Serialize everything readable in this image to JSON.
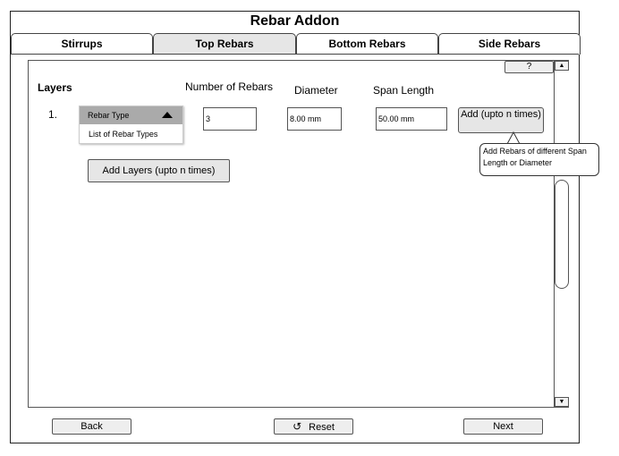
{
  "window": {
    "title": "Rebar Addon"
  },
  "tabs": [
    {
      "label": "Stirrups",
      "active": false
    },
    {
      "label": "Top Rebars",
      "active": true
    },
    {
      "label": "Bottom Rebars",
      "active": false
    },
    {
      "label": "Side Rebars",
      "active": false
    }
  ],
  "panel": {
    "help_label": "?",
    "layers_heading": "Layers",
    "columns": {
      "number_of_rebars": "Number of Rebars",
      "diameter": "Diameter",
      "span_length": "Span Length"
    },
    "row": {
      "index": "1.",
      "rebar_type": {
        "selected": "Rebar Type",
        "options": [
          "List of Rebar Types"
        ]
      },
      "number_of_rebars": "3",
      "diameter": "8.00 mm",
      "span_length": "50.00 mm",
      "add_label": "Add (upto n times)"
    },
    "tooltip": "Add Rebars of different Span Length or Diameter",
    "add_layers_label": "Add Layers (upto n times)"
  },
  "footer": {
    "back_label": "Back",
    "reset_label": "Reset",
    "next_label": "Next"
  },
  "icons": {
    "reset": "reset-icon",
    "scroll_up": "arrow-up-icon",
    "scroll_down": "arrow-down-icon",
    "dropdown": "triangle-up-icon"
  },
  "colors": {
    "active_tab": "#e6e6e6",
    "dropdown_header": "#aaaaaa",
    "button": "#e6e6e6"
  }
}
